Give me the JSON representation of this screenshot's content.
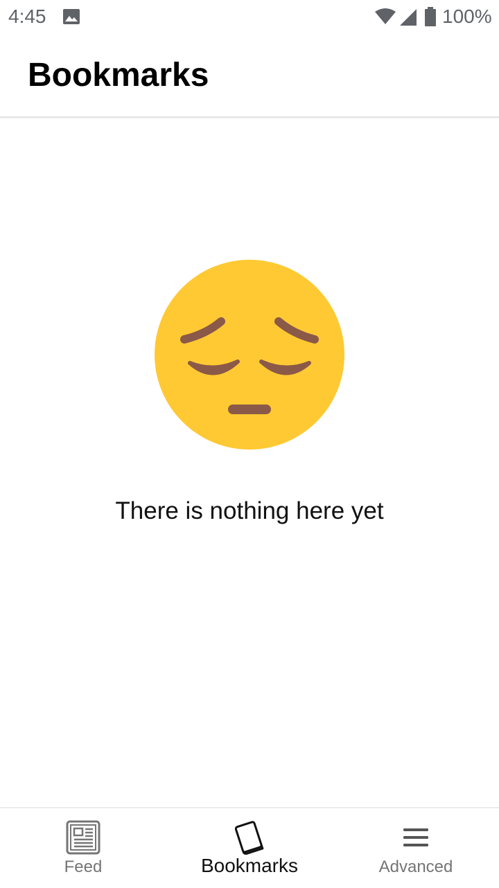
{
  "status_bar": {
    "time": "4:45",
    "battery": "100%",
    "icons": [
      "image-icon",
      "wifi-icon",
      "signal-icon",
      "battery-icon"
    ]
  },
  "app_bar": {
    "title": "Bookmarks"
  },
  "empty_state": {
    "icon": "pensive-face-icon",
    "message": "There is nothing here yet"
  },
  "bottom_nav": {
    "items": [
      {
        "label": "Feed",
        "icon": "newspaper-icon",
        "active": false
      },
      {
        "label": "Bookmarks",
        "icon": "book-icon",
        "active": true
      },
      {
        "label": "Advanced",
        "icon": "menu-icon",
        "active": false
      }
    ]
  },
  "colors": {
    "emoji_face": "#FFC933",
    "emoji_features": "#8A5948",
    "status_text": "#5F6368",
    "inactive_nav": "#757575",
    "active_nav": "#111111"
  }
}
